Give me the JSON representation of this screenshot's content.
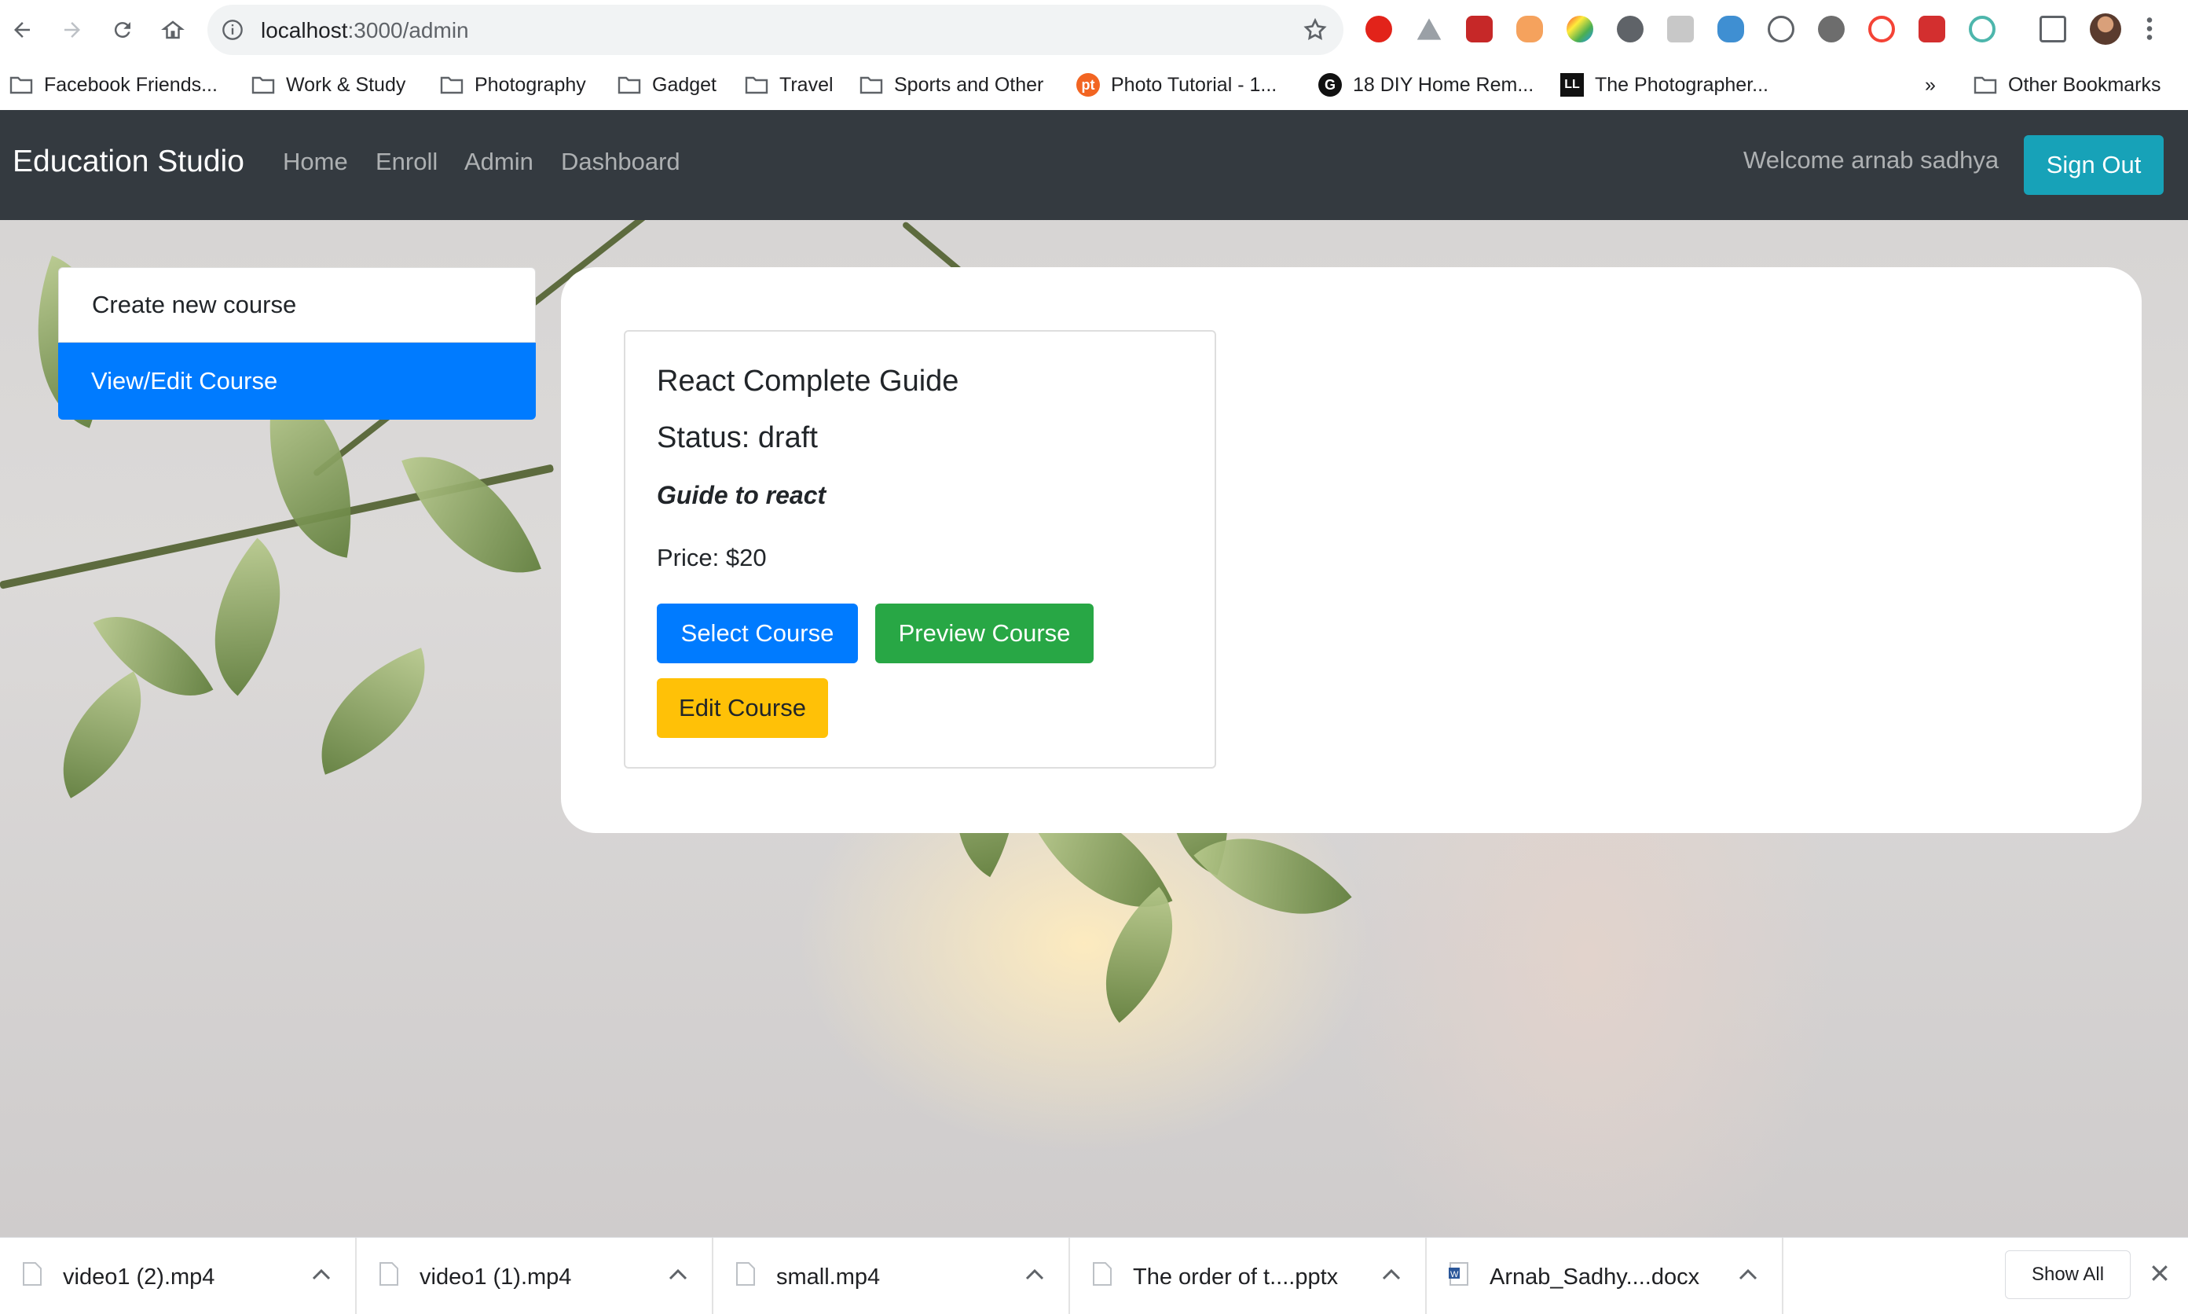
{
  "browser": {
    "url_host": "localhost",
    "url_path": ":3000/admin",
    "bookmarks": [
      {
        "label": "Facebook Friends...",
        "icon": "folder-icon"
      },
      {
        "label": "Work & Study",
        "icon": "folder-icon"
      },
      {
        "label": "Photography",
        "icon": "folder-icon"
      },
      {
        "label": "Gadget",
        "icon": "folder-icon"
      },
      {
        "label": "Travel",
        "icon": "folder-icon"
      },
      {
        "label": "Sports and Other",
        "icon": "folder-icon"
      },
      {
        "label": "Photo Tutorial - 1...",
        "icon": "pt-logo-icon"
      },
      {
        "label": "18 DIY Home Rem...",
        "icon": "g-logo-icon"
      },
      {
        "label": "The Photographer...",
        "icon": "ll-logo-icon"
      }
    ],
    "overflow": "»",
    "other_bookmarks": "Other Bookmarks"
  },
  "navbar": {
    "brand": "Education Studio",
    "links": [
      "Home",
      "Enroll",
      "Admin",
      "Dashboard"
    ],
    "welcome": "Welcome arnab sadhya",
    "sign_out": "Sign Out"
  },
  "sidebar": {
    "items": [
      {
        "label": "Create new course",
        "active": false
      },
      {
        "label": "View/Edit Course",
        "active": true
      }
    ]
  },
  "course": {
    "title": "React Complete Guide",
    "status": "Status: draft",
    "description": "Guide to react",
    "price": "Price: $20",
    "select_label": "Select Course",
    "preview_label": "Preview Course",
    "edit_label": "Edit Course"
  },
  "downloads": {
    "items": [
      "video1 (2).mp4",
      "video1 (1).mp4",
      "small.mp4",
      "The order of t....pptx",
      "Arnab_Sadhy....docx"
    ],
    "show_all": "Show All"
  },
  "colors": {
    "navbar_bg": "#343a40",
    "primary": "#007bff",
    "success": "#28a745",
    "warning": "#ffc107",
    "info": "#17a2b8"
  }
}
